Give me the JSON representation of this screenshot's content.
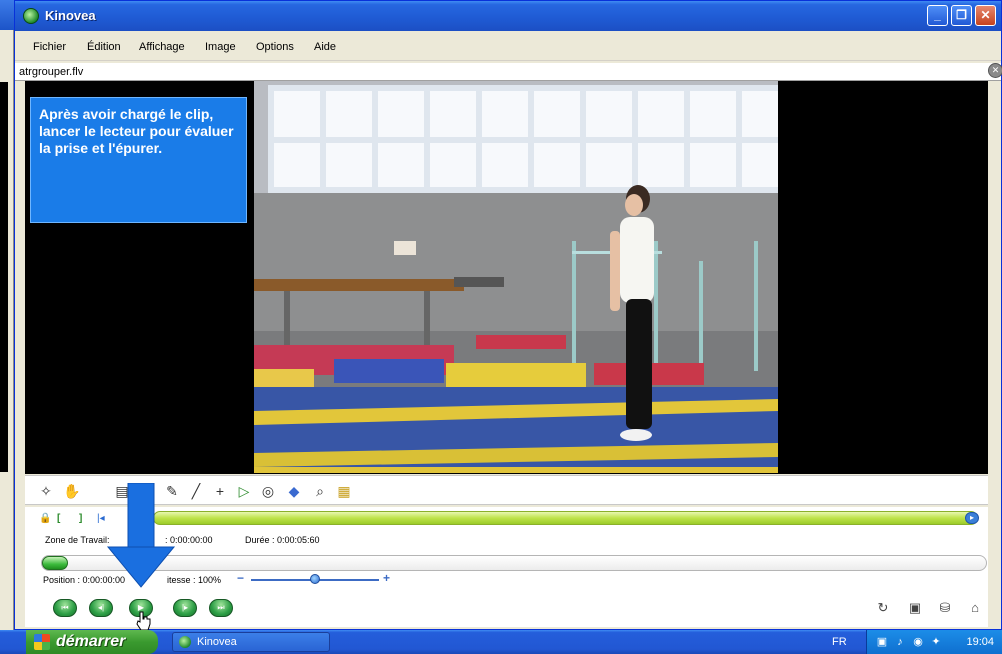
{
  "window": {
    "title": "Kinovea",
    "minimize": "_",
    "maximize": "❐",
    "close": "✕"
  },
  "menu": {
    "items": [
      "Fichier",
      "Édition",
      "Affichage",
      "Image",
      "Options",
      "Aide"
    ]
  },
  "file": {
    "name": "atrgrouper.flv"
  },
  "callout": {
    "text": "Après avoir chargé le clip, lancer le lecteur pour évaluer la prise et l'épurer."
  },
  "controls": {
    "zone_label": "Zone de Travail:",
    "zone_start": ": 0:00:00:00",
    "duration": "Durée : 0:00:05:60",
    "position": "Position : 0:00:00:00",
    "speed": "itesse : 100%",
    "speed_percent": 50
  },
  "taskbar": {
    "start_label": "démarrer",
    "task_label": "Kinovea",
    "lang": "FR",
    "clock": "19:04"
  },
  "colors": {
    "callout_bg": "#1a7ce8",
    "titlebar": "#2667e0",
    "arrow": "#1a6fe0"
  }
}
